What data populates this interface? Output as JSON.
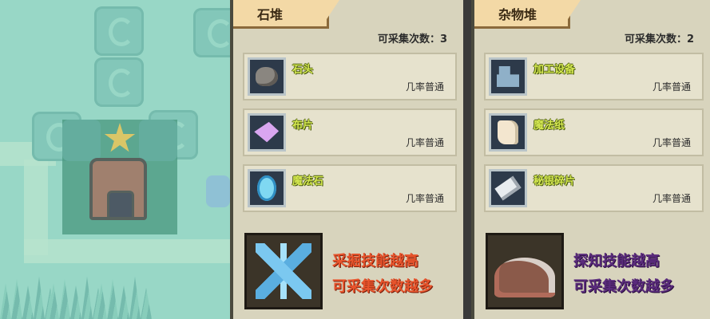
{
  "panels": [
    {
      "title": "石堆",
      "count_text": "可采集次数：3",
      "items": [
        {
          "name": "石头",
          "rate": "几率普通",
          "icon": "rock-icon"
        },
        {
          "name": "布片",
          "rate": "几率普通",
          "icon": "cloth-icon"
        },
        {
          "name": "魔法石",
          "rate": "几率普通",
          "icon": "magic-stone-icon"
        }
      ],
      "promo": {
        "icon": "crystal-icon",
        "line1": "采掘技能越高",
        "line2": "可采集次数越多",
        "color": "#e8542c"
      }
    },
    {
      "title": "杂物堆",
      "count_text": "可采集次数：2",
      "items": [
        {
          "name": "加工设备",
          "rate": "几率普通",
          "icon": "device-icon"
        },
        {
          "name": "魔法纸",
          "rate": "几率普通",
          "icon": "paper-icon"
        },
        {
          "name": "秘银碎片",
          "rate": "几率普通",
          "icon": "mithril-shard-icon"
        }
      ],
      "promo": {
        "icon": "debris-pile-icon",
        "line1": "探知技能越高",
        "line2": "可采集次数越多",
        "color": "#5a2b7c"
      }
    }
  ],
  "colors": {
    "panel_bg": "#d8d4bd",
    "title_tab": "#f3d9a6",
    "item_name": "#d4e850",
    "map_bg": "#8fcfbd",
    "selection": "#146e50",
    "star": "#f4b52c"
  }
}
